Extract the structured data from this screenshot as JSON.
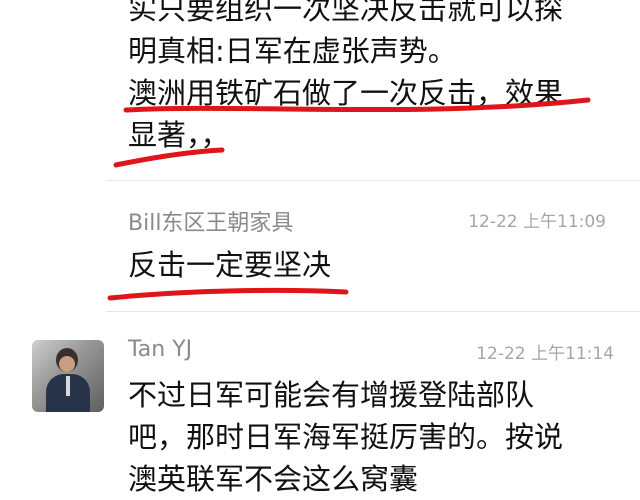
{
  "messages": [
    {
      "lines": [
        "实只要组织一次坚决反击就可以探",
        "明真相:日军在虚张声势。",
        "澳洲用铁矿石做了一次反击，效果",
        "显著，，"
      ]
    },
    {
      "sender": "Bill东区王朝家具",
      "time": "12-22 上午11:09",
      "lines": [
        "反击一定要坚决"
      ]
    },
    {
      "sender": "Tan YJ",
      "time": "12-22 上午11:14",
      "lines": [
        "不过日军可能会有增援登陆部队",
        "吧，那时日军海军挺厉害的。按说",
        "澳英联军不会这么窝囊"
      ]
    }
  ],
  "colors": {
    "highlight_underline": "#e0141b"
  }
}
